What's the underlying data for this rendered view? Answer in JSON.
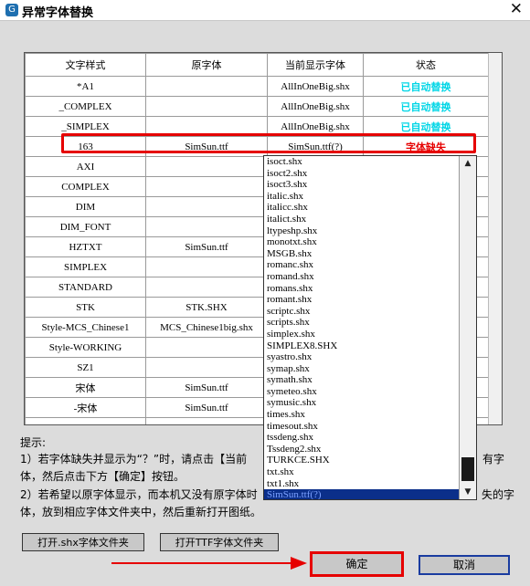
{
  "window": {
    "title": "异常字体替换",
    "close_label": "✕"
  },
  "table": {
    "headers": [
      "文字样式",
      "原字体",
      "当前显示字体",
      "状态"
    ],
    "rows": [
      {
        "style": "*A1",
        "original": "",
        "current": "AllInOneBig.shx",
        "status": "已自动替换"
      },
      {
        "style": "_COMPLEX",
        "original": "",
        "current": "AllInOneBig.shx",
        "status": "已自动替换"
      },
      {
        "style": "_SIMPLEX",
        "original": "",
        "current": "AllInOneBig.shx",
        "status": "已自动替换"
      },
      {
        "style": "163",
        "original": "SimSun.ttf",
        "current": "SimSun.ttf(?)",
        "status": "字体缺失"
      },
      {
        "style": "AXI",
        "original": "",
        "current": "",
        "status": ""
      },
      {
        "style": "COMPLEX",
        "original": "",
        "current": "",
        "status": ""
      },
      {
        "style": "DIM",
        "original": "",
        "current": "",
        "status": ""
      },
      {
        "style": "DIM_FONT",
        "original": "",
        "current": "",
        "status": ""
      },
      {
        "style": "HZTXT",
        "original": "SimSun.ttf",
        "current": "",
        "status": ""
      },
      {
        "style": "SIMPLEX",
        "original": "",
        "current": "",
        "status": ""
      },
      {
        "style": "STANDARD",
        "original": "",
        "current": "",
        "status": ""
      },
      {
        "style": "STK",
        "original": "STK.SHX",
        "current": "",
        "status": ""
      },
      {
        "style": "Style-MCS_Chinese1",
        "original": "MCS_Chinese1big.shx",
        "current": "",
        "status": ""
      },
      {
        "style": "Style-WORKING",
        "original": "",
        "current": "",
        "status": ""
      },
      {
        "style": "SZ1",
        "original": "",
        "current": "",
        "status": ""
      },
      {
        "style": "宋体",
        "original": "SimSun.ttf",
        "current": "",
        "status": ""
      },
      {
        "style": "-宋体",
        "original": "SimSun.ttf",
        "current": "",
        "status": ""
      },
      {
        "style": "",
        "original": "",
        "current": "",
        "status": ""
      }
    ]
  },
  "dropdown": {
    "items": [
      "isoct.shx",
      "isoct2.shx",
      "isoct3.shx",
      "italic.shx",
      "italicc.shx",
      "italict.shx",
      "ltypeshp.shx",
      "monotxt.shx",
      "MSGB.shx",
      "romanc.shx",
      "romand.shx",
      "romans.shx",
      "romant.shx",
      "scriptc.shx",
      "scripts.shx",
      "simplex.shx",
      "SIMPLEX8.SHX",
      "syastro.shx",
      "symap.shx",
      "symath.shx",
      "symeteo.shx",
      "symusic.shx",
      "times.shx",
      "timesout.shx",
      "tssdeng.shx",
      "Tssdeng2.shx",
      "TURKCE.SHX",
      "txt.shx",
      "txt1.shx",
      "SimSun.ttf(?)"
    ],
    "selected": "SimSun.ttf(?)"
  },
  "hints": {
    "heading": "提示:",
    "line1": "1）若字体缺失并显示为“？”时，请点击【当前",
    "line1_tail": "有字",
    "line2": "体，然后点击下方【确定】按钮。",
    "line3": "2）若希望以原字体显示，而本机又没有原字体时",
    "line3_tail": "失的字",
    "line4": "体，放到相应字体文件夹中，然后重新打开图纸。"
  },
  "buttons": {
    "open_shx": "打开.shx字体文件夹",
    "open_ttf": "打开TTF字体文件夹",
    "ok": "确定",
    "cancel": "取消"
  },
  "colors": {
    "status_ok": "#00d6e6",
    "status_missing": "#e60000",
    "annotation_red": "#e60000",
    "selection_blue": "#0b2f8a"
  }
}
